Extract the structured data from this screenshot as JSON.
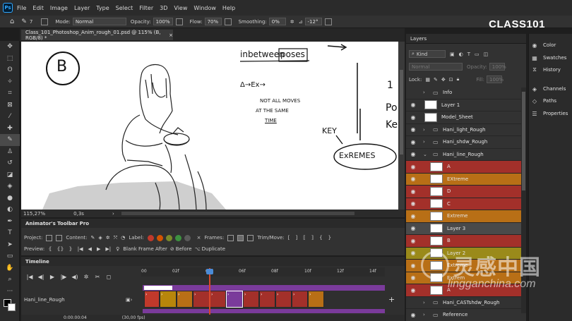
{
  "menu": {
    "app_icon": "Ps",
    "items": [
      "File",
      "Edit",
      "Image",
      "Layer",
      "Type",
      "Select",
      "Filter",
      "3D",
      "View",
      "Window",
      "Help"
    ]
  },
  "brand": {
    "logo_text": "CLASS101"
  },
  "options_bar": {
    "mode_label": "Mode:",
    "mode_value": "Normal",
    "opacity_label": "Opacity:",
    "opacity_value": "100%",
    "flow_label": "Flow:",
    "flow_value": "70%",
    "smoothing_label": "Smoothing:",
    "smoothing_value": "0%",
    "angle_value": "-12°",
    "brush_size": "7"
  },
  "document": {
    "tab_title": "Class_101_Photoshop_Anim_rough_01.psd @ 115% (B, RGB/8) *",
    "zoom_status": "115,27%",
    "status_extra": "0,3s"
  },
  "sketch": {
    "circle_letter": "B",
    "note_inbetween": "inbetween",
    "note_poses": "poses",
    "note_formula": "Δ→Ex→",
    "note_line1": "NOT ALL MOVES",
    "note_line2": "AT THE SAME",
    "note_line3": "TIME",
    "note_key": "KEY",
    "note_extremes": "ExREMES",
    "note_fragment1": "1",
    "note_fragment2": "Po",
    "note_fragment3": "Ke"
  },
  "animator": {
    "title": "Animator's Toolbar Pro",
    "project_label": "Project:",
    "content_label": "Content:",
    "label_label": "Label:",
    "frames_label": "Frames:",
    "trim_label": "Trim/Move:",
    "preview_label": "Preview:",
    "blank_after": "Blank Frame After",
    "before": "Before",
    "duplicate": "Duplicate",
    "label_colors": [
      "#c0392b",
      "#d35400",
      "#7a8a2a",
      "#3d9140",
      "#5a5a5a"
    ]
  },
  "timeline": {
    "title": "Timeline",
    "ruler": [
      "00",
      "02f",
      "04f",
      "06f",
      "08f",
      "10f",
      "12f",
      "14f"
    ],
    "playhead_frame": "04f",
    "track_name": "Hani_line_Rough",
    "timecode": "0:00:00:04",
    "fps": "(30,00 fps)"
  },
  "layers_panel": {
    "tab": "Layers",
    "kind_label": "Kind",
    "blend_mode": "Normal",
    "opacity_label": "Opacity:",
    "opacity_value": "100%",
    "lock_label": "Lock:",
    "fill_label": "Fill:",
    "fill_value": "100%",
    "layers": [
      {
        "name": "Info",
        "type": "group",
        "color": "#323232"
      },
      {
        "name": "Layer 1",
        "type": "layer",
        "color": "#323232"
      },
      {
        "name": "Model_Sheet",
        "type": "layer",
        "color": "#323232"
      },
      {
        "name": "Hani_light_Rough",
        "type": "group",
        "color": "#323232"
      },
      {
        "name": "Hani_shdw_Rough",
        "type": "group",
        "color": "#323232"
      },
      {
        "name": "Hani_line_Rough",
        "type": "group-open",
        "color": "#323232"
      },
      {
        "name": "A",
        "type": "layer",
        "color": "#a3302a"
      },
      {
        "name": "EXtreme",
        "type": "layer",
        "color": "#b86f16"
      },
      {
        "name": "D",
        "type": "layer",
        "color": "#a3302a"
      },
      {
        "name": "C",
        "type": "layer",
        "color": "#a3302a"
      },
      {
        "name": "Extreme",
        "type": "layer",
        "color": "#b86f16"
      },
      {
        "name": "Layer 3",
        "type": "layer",
        "color": "#4a4a4a"
      },
      {
        "name": "B",
        "type": "layer",
        "color": "#a3302a"
      },
      {
        "name": "Layer 2",
        "type": "layer",
        "color": "#9a8a1a"
      },
      {
        "name": "Extreme",
        "type": "layer",
        "color": "#b86f16"
      },
      {
        "name": "Extrem",
        "type": "layer",
        "color": "#b86f16"
      },
      {
        "name": "A",
        "type": "layer",
        "color": "#a3302a"
      },
      {
        "name": "Hani_CASTshdw_Rough",
        "type": "group",
        "color": "#323232"
      },
      {
        "name": "Reference",
        "type": "group",
        "color": "#323232"
      }
    ]
  },
  "dock": {
    "items": [
      {
        "label": "Color",
        "icon": "palette-icon"
      },
      {
        "label": "Swatches",
        "icon": "grid-icon"
      },
      {
        "label": "History",
        "icon": "history-icon"
      },
      {
        "label": "Channels",
        "icon": "channels-icon"
      },
      {
        "label": "Paths",
        "icon": "paths-icon"
      },
      {
        "label": "Properties",
        "icon": "properties-icon"
      }
    ]
  },
  "watermark": {
    "line1": "灵感中国",
    "line2": "lingganchina.com"
  }
}
